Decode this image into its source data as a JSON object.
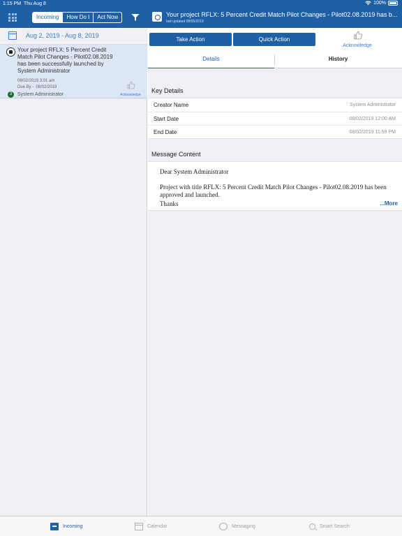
{
  "status_bar": {
    "time": "1:15 PM",
    "date": "Thu Aug 8",
    "battery": "100%"
  },
  "left": {
    "segments": [
      "Incoming",
      "How Do I",
      "Act Now"
    ],
    "active_segment": "Incoming",
    "date_range": "Aug 2, 2019 - Aug 8, 2019",
    "messages": [
      {
        "title": "Your project RFLX: 5 Percent Credit Match Pilot Changes - Pilot02.08.2019 has been successfully launched by System Administrator",
        "date": "08/02/2019 3:01 am",
        "due_label": "Due By -",
        "due_date": "08/02/2019",
        "badge": "3",
        "sender": "System Administrator",
        "acknowledge": "Acknowledge"
      }
    ]
  },
  "detail": {
    "title": "Your project RFLX: 5 Percent Credit Match Pilot Changes - Pilot02.08.2019 has b...",
    "updated": "last updated 08/05/2019",
    "actions": {
      "take": "Take Action",
      "quick": "Quick Action",
      "acknowledge": "Acknowledge"
    },
    "tabs": {
      "details": "Details",
      "history": "History"
    },
    "key_details": {
      "title": "Key Details",
      "rows": [
        {
          "label": "Creator Name",
          "value": "System Administrator"
        },
        {
          "label": "Start Date",
          "value": "08/02/2019 12:00 AM"
        },
        {
          "label": "End Date",
          "value": "08/02/2019 11:59 PM"
        }
      ]
    },
    "message_content": {
      "title": "Message Content",
      "greeting": "Dear System Administrator",
      "body": "Project with title RFLX: 5 Percent Credit Match Pilot Changes - Pilot02.08.2019 has been approved and launched.",
      "thanks": "Thanks",
      "more": "...More"
    }
  },
  "tabbar": {
    "incoming": "Incoming",
    "calendar": "Calendar",
    "messaging": "Messaging",
    "search": "Smart Search"
  },
  "colors": {
    "brand": "#1f5fa6",
    "link": "#3a7bd5",
    "selected_row": "#dce6f5",
    "badge": "#1c6b2e"
  }
}
